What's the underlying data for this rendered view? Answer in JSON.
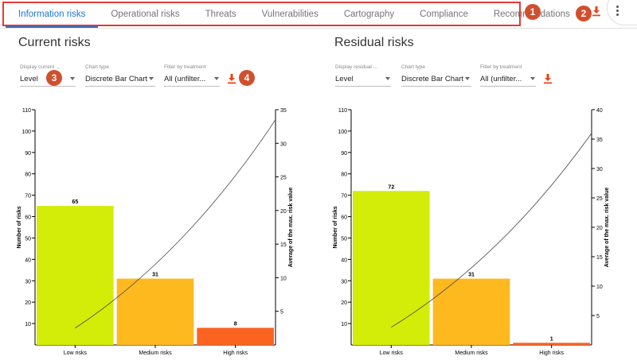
{
  "tabs": [
    {
      "label": "Information risks",
      "active": true
    },
    {
      "label": "Operational risks",
      "active": false
    },
    {
      "label": "Threats",
      "active": false
    },
    {
      "label": "Vulnerabilities",
      "active": false
    },
    {
      "label": "Cartography",
      "active": false
    },
    {
      "label": "Compliance",
      "active": false
    },
    {
      "label": "Recommendations",
      "active": false
    }
  ],
  "callouts": {
    "one": "1",
    "two": "2",
    "three": "3",
    "four": "4"
  },
  "colors": {
    "accent": "#1976d2",
    "highlight": "#e53935",
    "callout": "#d14f2e",
    "download": "#e8441a",
    "low": "#d4ed08",
    "medium": "#fdb91e",
    "high": "#fb6420"
  },
  "icons": {
    "download": "download-icon",
    "menu": "more-vert-icon",
    "dropdown": "arrow-drop-down-icon"
  },
  "current": {
    "title": "Current risks",
    "display": {
      "label": "Display current ...",
      "value": "Level"
    },
    "chart_type": {
      "label": "Chart type",
      "value": "Discrete Bar Chart"
    },
    "filter": {
      "label": "Filter by treatment",
      "value": "All (unfilter..."
    }
  },
  "residual": {
    "title": "Residual risks",
    "display": {
      "label": "Display residual ...",
      "value": "Level"
    },
    "chart_type": {
      "label": "Chart type",
      "value": "Discrete Bar Chart"
    },
    "filter": {
      "label": "Filter by treatment",
      "value": "All (unfilter..."
    }
  },
  "chart_data": [
    {
      "type": "bar",
      "title": "Current risks",
      "categories": [
        "Low risks",
        "Medium risks",
        "High risks"
      ],
      "values": [
        65,
        31,
        8
      ],
      "colors": [
        "#d4ed08",
        "#fdb91e",
        "#fb6420"
      ],
      "ylabel": "Number of risks",
      "ylim": [
        0,
        110
      ],
      "yticks": [
        10,
        20,
        30,
        40,
        50,
        60,
        70,
        80,
        90,
        100,
        110
      ],
      "y2label": "Average of the max. risk value",
      "y2lim": [
        0,
        35
      ],
      "y2ticks": [
        5,
        10,
        15,
        20,
        25,
        30,
        35
      ],
      "line": {
        "start": [
          0,
          2.5
        ],
        "end": [
          2.5,
          33.5
        ],
        "curvature": 0.15
      }
    },
    {
      "type": "bar",
      "title": "Residual risks",
      "categories": [
        "Low risks",
        "Medium risks",
        "High risks"
      ],
      "values": [
        72,
        31,
        1
      ],
      "colors": [
        "#d4ed08",
        "#fdb91e",
        "#fb6420"
      ],
      "ylabel": "Number of risks",
      "ylim": [
        0,
        110
      ],
      "yticks": [
        10,
        20,
        30,
        40,
        50,
        60,
        70,
        80,
        90,
        100,
        110
      ],
      "y2label": "Average of the max. risk value",
      "y2lim": [
        0,
        40
      ],
      "y2ticks": [
        5,
        10,
        15,
        20,
        25,
        30,
        35,
        40
      ],
      "line": {
        "start": [
          0,
          3
        ],
        "end": [
          2.5,
          36
        ],
        "curvature": 0.15
      }
    }
  ]
}
